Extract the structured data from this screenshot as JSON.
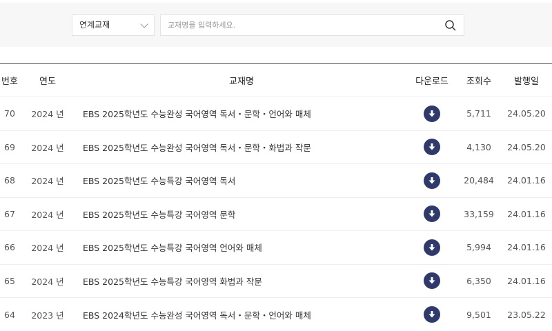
{
  "search": {
    "category": "연계교재",
    "placeholder": "교재명을 입력하세요."
  },
  "table": {
    "headers": [
      "번호",
      "연도",
      "교재명",
      "다운로드",
      "조회수",
      "발행일"
    ],
    "rows": [
      {
        "no": "70",
        "year": "2024 년",
        "title": "EBS 2025학년도 수능완성 국어영역 독서・문학・언어와 매체",
        "views": "5,711",
        "date": "24.05.20"
      },
      {
        "no": "69",
        "year": "2024 년",
        "title": "EBS 2025학년도 수능완성 국어영역 독서・문학・화법과 작문",
        "views": "4,130",
        "date": "24.05.20"
      },
      {
        "no": "68",
        "year": "2024 년",
        "title": "EBS 2025학년도 수능특강 국어영역 독서",
        "views": "20,484",
        "date": "24.01.16"
      },
      {
        "no": "67",
        "year": "2024 년",
        "title": "EBS 2025학년도 수능특강 국어영역 문학",
        "views": "33,159",
        "date": "24.01.16"
      },
      {
        "no": "66",
        "year": "2024 년",
        "title": "EBS 2025학년도 수능특강 국어영역 언어와 매체",
        "views": "5,994",
        "date": "24.01.16"
      },
      {
        "no": "65",
        "year": "2024 년",
        "title": "EBS 2025학년도 수능특강 국어영역 화법과 작문",
        "views": "6,350",
        "date": "24.01.16"
      },
      {
        "no": "64",
        "year": "2023 년",
        "title": "EBS 2024학년도 수능완성 국어영역 독서・문학・언어와 매체",
        "views": "9,501",
        "date": "23.05.22"
      }
    ]
  },
  "colors": {
    "icon": "#2f3a6b"
  }
}
